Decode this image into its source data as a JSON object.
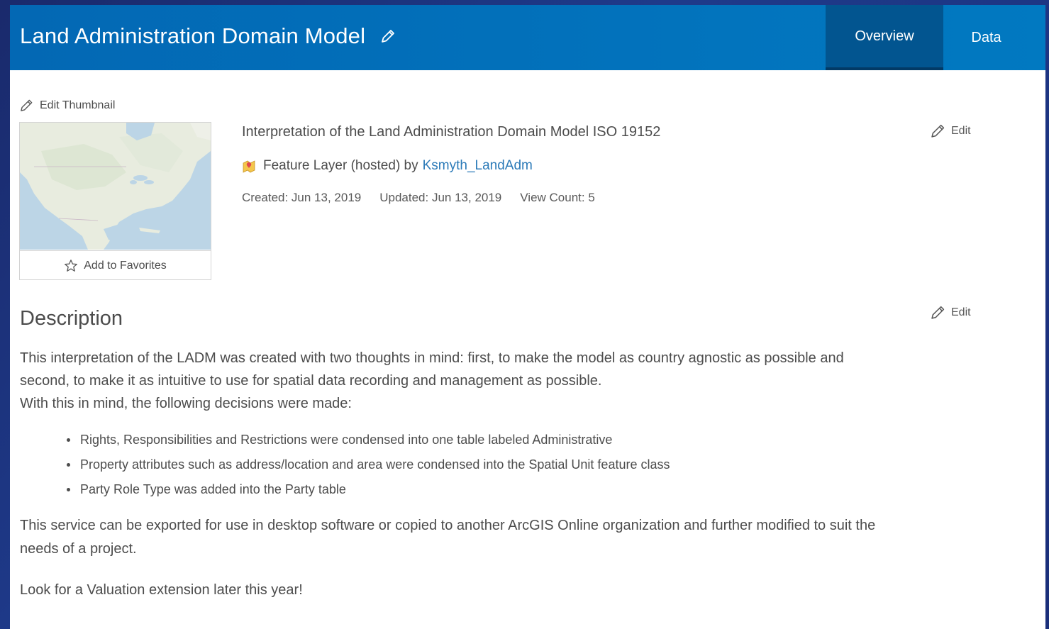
{
  "header": {
    "title": "Land Administration Domain Model",
    "tabs": [
      {
        "label": "Overview",
        "active": true
      },
      {
        "label": "Data",
        "active": false
      }
    ]
  },
  "thumbnail": {
    "edit_label": "Edit Thumbnail",
    "favorites_label": "Add to Favorites"
  },
  "item": {
    "summary": "Interpretation of the Land Administration Domain Model ISO 19152",
    "edit_label": "Edit",
    "type_text": "Feature Layer (hosted) by",
    "owner": "Ksmyth_LandAdm",
    "created": "Created: Jun 13, 2019",
    "updated": "Updated: Jun 13, 2019",
    "view_count": "View Count: 5"
  },
  "description": {
    "heading": "Description",
    "edit_label": "Edit",
    "line1": "This interpretation of the LADM was created with two thoughts in mind: first, to make the model as country agnostic as possible and",
    "line2": "second, to make it as intuitive to use for spatial data recording and management as possible.",
    "line3": "With this in mind, the following decisions were made:",
    "bullets": [
      "Rights, Responsibilities and Restrictions were condensed into one table labeled Administrative",
      "Property attributes such as address/location and area were condensed into the Spatial Unit feature class",
      "Party Role Type was added into the Party table"
    ],
    "para2_line1": "This service can be exported for use in desktop software or copied to another ArcGIS Online organization and further modified to suit the",
    "para2_line2": "needs of a project.",
    "para3": "Look for a Valuation extension later this year!"
  },
  "colors": {
    "header_bg": "#0179c1",
    "active_tab_bg": "#025590",
    "link": "#2b7ab8"
  }
}
